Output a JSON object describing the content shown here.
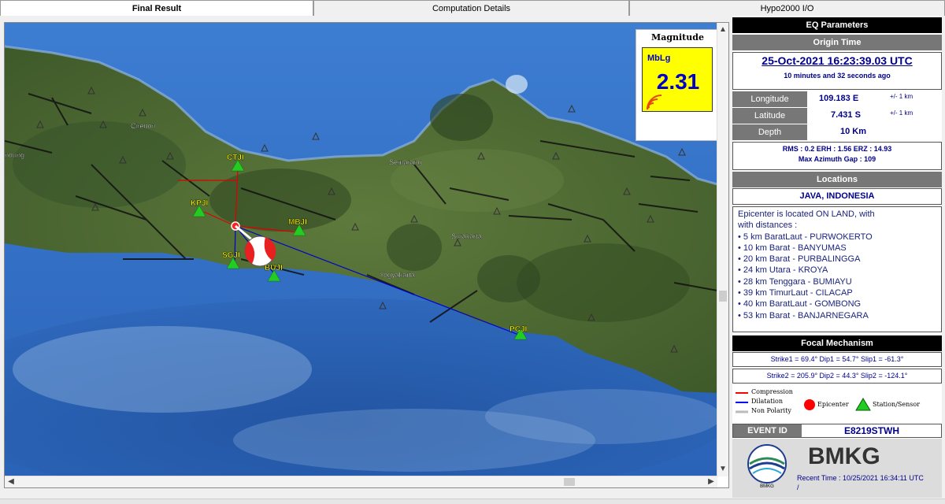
{
  "tabs": [
    {
      "label": "Final Result",
      "active": true
    },
    {
      "label": "Computation Details",
      "active": false
    },
    {
      "label": "Hypo2000 I/O",
      "active": false
    }
  ],
  "magnitude": {
    "title": "Magnitude",
    "type": "MbLg",
    "value": "2.31"
  },
  "map": {
    "cities": [
      "Cirebon",
      "Semarang",
      "Surakarta",
      "Yogyakarta",
      "ndung"
    ],
    "stations": [
      "CTJI",
      "KPJI",
      "MBJI",
      "SGJI",
      "BUJI",
      "PCJI"
    ]
  },
  "panel": {
    "eq_title": "EQ Parameters",
    "origin_title": "Origin Time",
    "origin_time": "25-Oct-2021 16:23:39.03 UTC",
    "elapsed": "10 minutes and 32 seconds  ago",
    "longitude": {
      "label": "Longitude",
      "value": "109.183 E",
      "err": "+/- 1 km"
    },
    "latitude": {
      "label": "Latitude",
      "value": "7.431 S",
      "err": "+/- 1 km"
    },
    "depth": {
      "label": "Depth",
      "value": "10 Km"
    },
    "rms": "RMS : 0.2  ERH : 1.56  ERZ : 14.93",
    "gap": "Max Azimuth Gap : 109",
    "locations_title": "Locations",
    "region": "JAVA, INDONESIA",
    "loc_intro1": "Epicenter is located ON LAND, with",
    "loc_intro2": "with distances :",
    "distances": [
      "• 5 km BaratLaut - PURWOKERTO",
      "• 10 km Barat - BANYUMAS",
      "• 20 km Barat - PURBALINGGA",
      "• 24 km Utara - KROYA",
      "• 28 km Tenggara - BUMIAYU",
      "• 39 km TimurLaut - CILACAP",
      "• 40 km BaratLaut - GOMBONG",
      "• 53 km Barat - BANJARNEGARA"
    ],
    "focal_title": "Focal Mechanism",
    "strike1": "Strike1 = 69.4° Dip1 = 54.7° Slip1 = -61.3°",
    "strike2": "Strike2 = 205.9° Dip2 = 44.3° Slip2 = -124.1°",
    "legend": {
      "compression": "Compression",
      "dilatation": "Dilatation",
      "non_polarity": "Non Polarity",
      "epicenter": "Epicenter",
      "station": "Station/Sensor",
      "color_compression": "#ff0000",
      "color_dilatation": "#0000ff",
      "color_nonpolarity": "#ffffff"
    },
    "event_label": "EVENT ID",
    "event_id": "E8219STWH",
    "agency": "BMKG",
    "logo_text": "BMKG",
    "recent_time": "Recent Time : 10/25/2021 16:34:11 UTC",
    "recent_slash": "/"
  }
}
